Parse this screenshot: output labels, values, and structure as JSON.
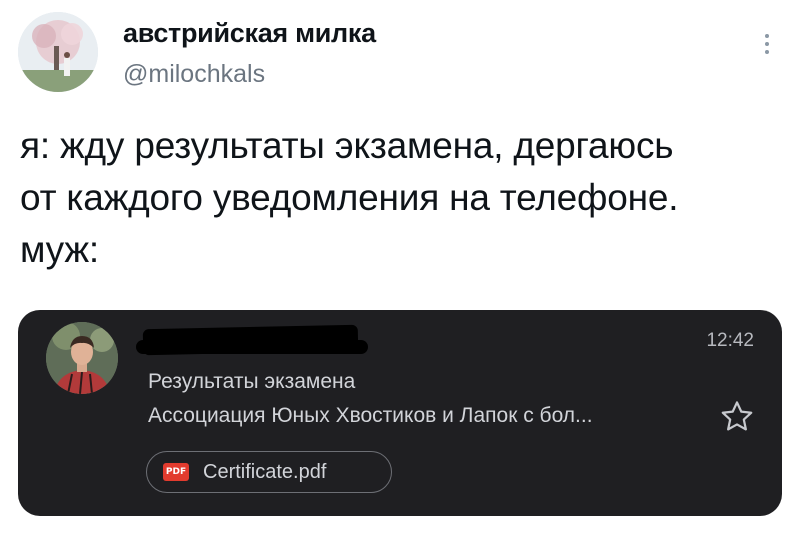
{
  "tweet": {
    "display_name": "австрийская милка",
    "handle": "@milochkals",
    "text_lines": [
      "я: жду результаты экзамена, дергаюсь",
      "от каждого уведомления на телефоне.",
      "муж:"
    ]
  },
  "notification": {
    "time": "12:42",
    "subject": "Результаты экзамена",
    "snippet": "Ассоциация Юных Хвостиков и Лапок с бол...",
    "attachment": {
      "badge": "PDF",
      "name": "Certificate.pdf"
    }
  },
  "icons": {
    "more": "more-vertical-icon",
    "star": "star-outline-icon",
    "pdf": "pdf-file-icon"
  },
  "colors": {
    "card_background": "#1f1f22",
    "handle": "#6b7580",
    "pdf_badge": "#e23b2e"
  }
}
